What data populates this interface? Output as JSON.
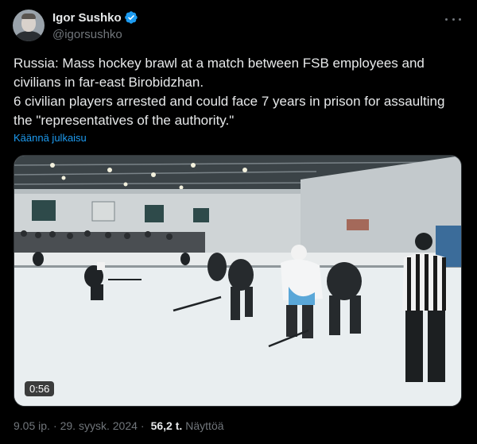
{
  "author": {
    "display_name": "Igor Sushko",
    "handle": "@igorsushko",
    "verified_icon": "verified-badge-icon",
    "verified_color": "#1d9bf0"
  },
  "tweet": {
    "lines": [
      "Russia: Mass hockey brawl at a match between FSB employees and civilians in far-east Birobidzhan.",
      "6 civilian players arrested and could face 7 years in prison for assaulting the \"representatives of the authority.\""
    ],
    "translate_link": "Käännä julkaisu"
  },
  "media": {
    "duration": "0:56"
  },
  "meta": {
    "time": "9.05 ip.",
    "date": "29. syysk. 2024",
    "separator": "·",
    "views_count": "56,2 t.",
    "views_label": "Näyttöä"
  },
  "colors": {
    "background": "#000000",
    "text": "#e7e9ea",
    "secondary": "#71767b",
    "link": "#1d9bf0"
  }
}
